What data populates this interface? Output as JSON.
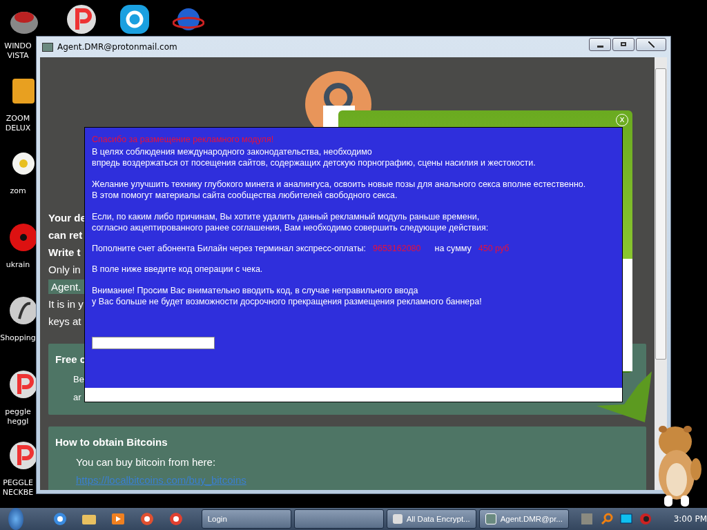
{
  "desktop_icons": [
    {
      "kind": "button",
      "lines": [
        "WINDO",
        "VISTA"
      ]
    },
    {
      "kind": "zoom",
      "lines": [
        "ZOOM",
        "DELUX"
      ]
    },
    {
      "kind": "flower",
      "lines": [
        "zom"
      ]
    },
    {
      "kind": "radiation",
      "lines": [
        "ukrain"
      ]
    },
    {
      "kind": "flash",
      "lines": [
        "Shopping"
      ]
    },
    {
      "kind": "peggle",
      "lines": [
        "peggle",
        "heggl"
      ]
    },
    {
      "kind": "peggle",
      "lines": [
        "PEGGLE",
        "NECKBE"
      ]
    }
  ],
  "top_icons": [
    {
      "kind": "peggle"
    },
    {
      "kind": "skype"
    },
    {
      "kind": "globe"
    }
  ],
  "window": {
    "title": "Agent.DMR@protonmail.com",
    "lines": [
      {
        "kind": "bold",
        "text": "Your de"
      },
      {
        "kind": "bold",
        "text": "can ret"
      },
      {
        "kind": "bold",
        "text": "Write t"
      },
      {
        "kind": "plain",
        "text": "Only in"
      },
      {
        "kind": "email",
        "text": "Agent."
      },
      {
        "kind": "plain",
        "text": "It is in y"
      },
      {
        "kind": "plain",
        "text": "keys at"
      }
    ],
    "free_box": {
      "title": "Free c",
      "lines": [
        "Be",
        "ar"
      ]
    },
    "bitcoin_box": {
      "title": "How to obtain Bitcoins",
      "text": "You can buy bitcoin from here:",
      "link": "https://localbitcoins.com/buy_bitcoins"
    }
  },
  "popup": {
    "close": "x"
  },
  "banner": {
    "heading": "Спасибо за размещение рекламного модуля!",
    "paragraphs": [
      {
        "kind": "text",
        "lines": [
          "В целях соблюдения международного законодательства, необходимо",
          "впредь воздержаться от посещения сайтов, содержащих детскую порнографию, сцены насилия и жестокости."
        ]
      },
      {
        "kind": "text",
        "lines": [
          "Желание улучшить технику глубокого минета и аналингуса, освоить новые позы для анального секса вполне естественно.",
          "В этом помогут материалы сайта сообщества любителей свободного секса."
        ]
      },
      {
        "kind": "text",
        "lines": [
          "Если, по каким либо причинам, Вы хотите удалить данный рекламный модуль раньше времени,",
          "согласно акцептированного ранее соглашения, Вам необходимо совершить следующие действия:"
        ]
      },
      {
        "kind": "payment",
        "before": "Пополните счет абонента Билайн через терминал экспресс-оплаты:",
        "phone": "9653162080",
        "middle": "на сумму",
        "amount": "450 руб"
      },
      {
        "kind": "text",
        "lines": [
          "В поле ниже введите код операции с чека."
        ]
      },
      {
        "kind": "text",
        "lines": [
          "Внимание! Просим Вас внимательно вводить код, в случае неправильного ввода",
          "у Вас больше не будет возможности досрочного прекращения размещения рекламного баннера!"
        ]
      }
    ]
  },
  "taskbar": {
    "quick_launch": [
      {
        "kind": "ie"
      },
      {
        "kind": "folder"
      },
      {
        "kind": "media"
      },
      {
        "kind": "paint"
      },
      {
        "kind": "chrome"
      }
    ],
    "buttons": [
      {
        "kind": "hamster",
        "label": "Login"
      },
      {
        "kind": "hamster"
      },
      {
        "kind": "drive",
        "label": "All Data Encrypt..."
      },
      {
        "kind": "window",
        "label": "Agent.DMR@pr..."
      }
    ],
    "clock": "3:00 PM"
  }
}
